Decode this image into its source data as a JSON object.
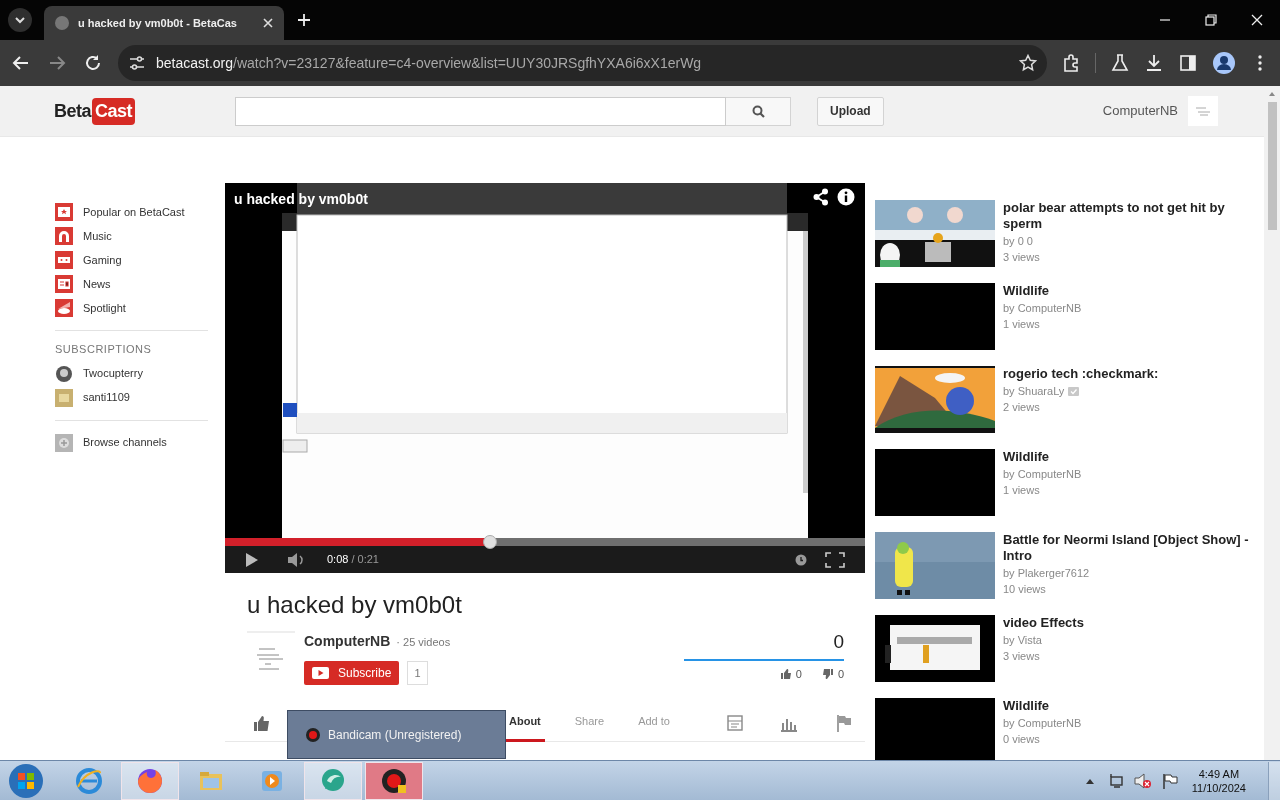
{
  "browser": {
    "tab_title": "u hacked by vm0b0t - BetaCas",
    "url_host": "betacast.org",
    "url_path": "/watch?v=23127&feature=c4-overview&list=UUY30JRSgfhYXA6i6xX1erWg"
  },
  "header": {
    "logo_left": "Beta",
    "logo_right": "Cast",
    "upload": "Upload",
    "user": "ComputerNB"
  },
  "sidebar": {
    "items": [
      {
        "label": "Popular on BetaCast"
      },
      {
        "label": "Music"
      },
      {
        "label": "Gaming"
      },
      {
        "label": "News"
      },
      {
        "label": "Spotlight"
      }
    ],
    "subscriptions_heading": "SUBSCRIPTIONS",
    "subscriptions": [
      {
        "label": "Twocupterry"
      },
      {
        "label": "santi1109"
      }
    ],
    "browse": "Browse channels"
  },
  "player": {
    "title": "u hacked by vm0b0t",
    "time_current": "0:08",
    "time_total": "/ 0:21",
    "level": 0.414
  },
  "video": {
    "title": "u hacked by vm0b0t",
    "channel": "ComputerNB",
    "video_count": "· 25 videos",
    "subscribe": "Subscribe",
    "subscriber_count": "1",
    "views": "0",
    "likes": "0",
    "dislikes": "0"
  },
  "action_tabs": [
    {
      "label": "About",
      "selected": true
    },
    {
      "label": "Share",
      "selected": false
    },
    {
      "label": "Add to",
      "selected": false
    }
  ],
  "related": [
    {
      "title": "polar bear attempts to not get hit by sperm",
      "channel": "by 0 0",
      "views": "3 views",
      "kind": "picture",
      "verified": false
    },
    {
      "title": "Wildlife",
      "channel": "by ComputerNB",
      "views": "1 views",
      "kind": "blank",
      "verified": false
    },
    {
      "title": "rogerio tech :checkmark:",
      "channel": "by ShuaraLy",
      "views": "2 views",
      "kind": "picture",
      "verified": true
    },
    {
      "title": "Wildlife",
      "channel": "by ComputerNB",
      "views": "1 views",
      "kind": "blank",
      "verified": false
    },
    {
      "title": "Battle for Neormi Island [Object Show] - Intro",
      "channel": "by Plakerger7612",
      "views": "10 views",
      "kind": "picture",
      "verified": false
    },
    {
      "title": "video Effects",
      "channel": "by Vista",
      "views": "3 views",
      "kind": "picture",
      "verified": false
    },
    {
      "title": "Wildlife",
      "channel": "by ComputerNB",
      "views": "0 views",
      "kind": "blank",
      "verified": false
    }
  ],
  "popup": {
    "label": "Bandicam (Unregistered)"
  },
  "taskbar": {
    "apps": [
      {
        "open": false,
        "hovered": false
      },
      {
        "open": true,
        "hovered": false
      },
      {
        "open": false,
        "hovered": false
      },
      {
        "open": false,
        "hovered": false
      },
      {
        "open": true,
        "hovered": false
      },
      {
        "open": true,
        "hovered": true
      }
    ],
    "time": "4:49 AM",
    "date": "11/10/2024"
  }
}
